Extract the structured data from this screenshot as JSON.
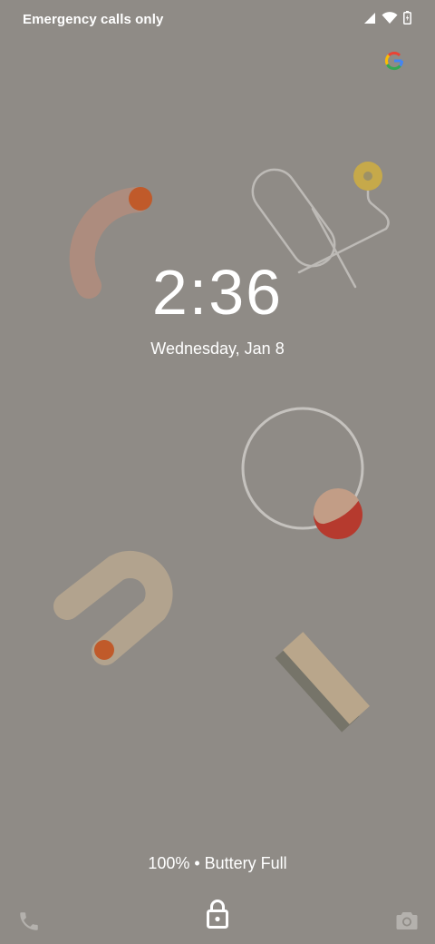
{
  "status_bar": {
    "carrier_text": "Emergency calls only",
    "icons": [
      "signal-icon",
      "wifi-icon",
      "battery-charging-icon"
    ]
  },
  "google_logo": "google-icon",
  "lock_screen": {
    "time": "2:36",
    "date": "Wednesday, Jan 8",
    "charging_status": "100% • Buttery Full"
  },
  "bottom_bar": {
    "left_shortcut": "phone-icon",
    "center_icon": "lock-icon",
    "right_shortcut": "camera-icon"
  },
  "colors": {
    "background": "#8f8b86",
    "text": "#ffffff",
    "accent_orange": "#c05a2a",
    "accent_red": "#b63a2e",
    "accent_yellow": "#c6a94a",
    "tan": "#b9a68b"
  }
}
